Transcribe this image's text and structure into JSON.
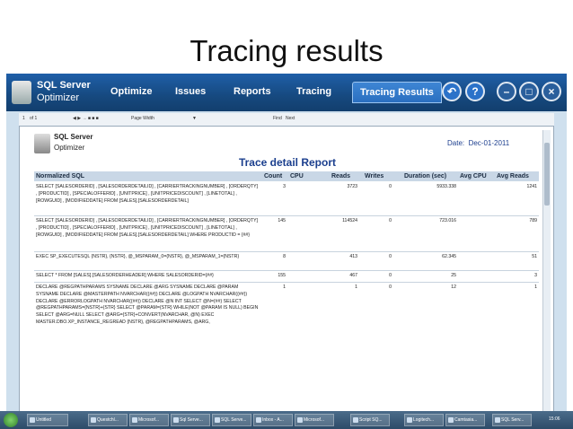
{
  "slide": {
    "title": "Tracing results"
  },
  "app": {
    "logo_line1": "SQL Server",
    "logo_line2": "Optimizer",
    "menu": [
      "Optimize",
      "Issues",
      "Reports",
      "Tracing",
      "Tracing Results"
    ],
    "active_menu": "Tracing Results"
  },
  "toolbar": {
    "page": "1",
    "of_pages": "of 1",
    "zoom": "Page Width",
    "find": "Find",
    "next": "Next"
  },
  "report": {
    "logo_line1": "SQL Server",
    "logo_line2": "Optimizer",
    "date_label": "Date:",
    "date_value": "Dec-01-2011",
    "title": "Trace detail Report",
    "columns": [
      "Normalized SQL",
      "Count",
      "CPU",
      "Reads",
      "Writes",
      "Duration (sec)",
      "Avg CPU",
      "Avg Reads"
    ],
    "rows": [
      {
        "sql": "SELECT [SALESORDERID] , [SALESORDERDETAILID] , [CARRIERTRACKINGNUMBER] , [ORDERQTY] , [PRODUCTID] , [SPECIALOFFERID] , [UNITPRICE] , [UNITPRICEDISCOUNT] , [LINETOTAL] , [ROWGUID] , [MODIFIEDDATE] FROM [SALES].[SALESORDERDETAIL]",
        "count": "3",
        "cpu": "",
        "reads": "3723",
        "writes": "0",
        "duration": "5933.338",
        "avg_cpu": "",
        "avg_reads": "1241"
      },
      {
        "sql": "SELECT [SALESORDERID] , [SALESORDERDETAILID] , [CARRIERTRACKINGNUMBER] , [ORDERQTY] , [PRODUCTID] , [SPECIALOFFERID] , [UNITPRICE] , [UNITPRICEDISCOUNT] , [LINETOTAL] , [ROWGUID] , [MODIFIEDDATE] FROM [SALES].[SALESORDERDETAIL] WHERE PRODUCTID = {##}",
        "count": "145",
        "cpu": "",
        "reads": "114524",
        "writes": "0",
        "duration": "723.016",
        "avg_cpu": "",
        "avg_reads": "789"
      },
      {
        "sql": "EXEC SP_EXECUTESQL {NSTR}, {NSTR}, @_MSPARAM_0={NSTR}, @_MSPARAM_1={NSTR}",
        "count": "8",
        "cpu": "",
        "reads": "413",
        "writes": "0",
        "duration": "62.345",
        "avg_cpu": "",
        "avg_reads": "51"
      },
      {
        "sql": "SELECT * FROM [SALES].[SALESORDERHEADER] WHERE SALESORDERID={##}",
        "count": "155",
        "cpu": "",
        "reads": "467",
        "writes": "0",
        "duration": "25",
        "avg_cpu": "",
        "avg_reads": "3"
      },
      {
        "sql": "DECLARE @REGPATHPARAMS SYSNAME DECLARE @ARG SYSNAME DECLARE @PARAM SYSNAME DECLARE @MASTERPATH NVARCHAR({##}) DECLARE @LOGPATH NVARCHAR({##}) DECLARE @ERRORLOGPATH NVARCHAR({##}) DECLARE @N INT SELECT @N={##} SELECT @REGPATHPARAMS={NSTR}+{STR} SELECT @PARAM={STR} WHILE(NOT @PARAM IS NULL) BEGIN SELECT @ARG=NULL SELECT @ARG={STR}+CONVERT(NVARCHAR, @N) EXEC MASTER.DBO.XP_INSTANCE_REGREAD {NSTR}, @REGPATHPARAMS, @ARG,",
        "count": "1",
        "cpu": "",
        "reads": "1",
        "writes": "0",
        "duration": "12",
        "avg_cpu": "",
        "avg_reads": "1"
      }
    ]
  },
  "taskbar": {
    "tasks": [
      "Untitled",
      "Questchl...",
      "Microsof...",
      "Sql Serve...",
      "SQL Serve...",
      "Inbox - A...",
      "Microsof...",
      "Script SQ...",
      "Logitech...",
      "Camtasia...",
      "SQL Serv..."
    ],
    "clock": "15:06"
  }
}
